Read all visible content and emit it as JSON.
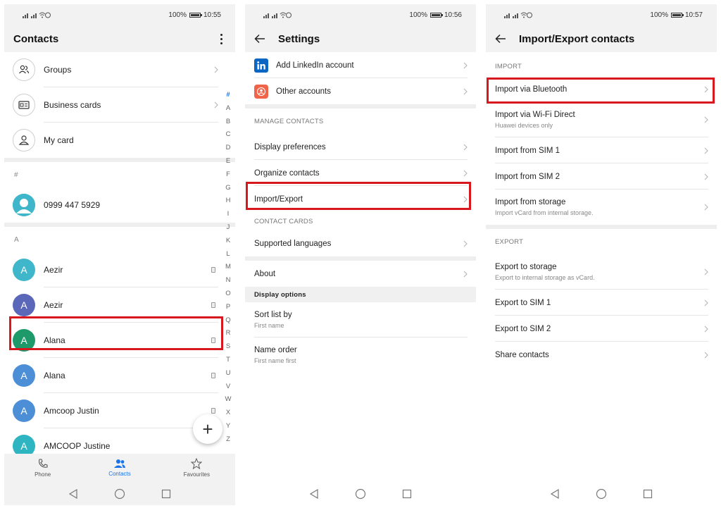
{
  "screens": [
    {
      "status": {
        "battery": "100%",
        "time": "10:55"
      },
      "title": "Contacts",
      "menu": [
        {
          "label": "Groups",
          "icon": "group-icon"
        },
        {
          "label": "Business cards",
          "icon": "business-card-icon"
        },
        {
          "label": "My card",
          "icon": "person-icon"
        }
      ],
      "hash_section": "#",
      "phone_contact": "0999 447 5929",
      "a_section": "A",
      "contacts": [
        {
          "initial": "A",
          "name": "Aezir",
          "color": "#3fb6c9"
        },
        {
          "initial": "A",
          "name": "Aezir",
          "color": "#5b67b8"
        },
        {
          "initial": "A",
          "name": "Alana",
          "color": "#1e9a6a"
        },
        {
          "initial": "A",
          "name": "Alana",
          "color": "#4d8fd6"
        },
        {
          "initial": "A",
          "name": "Amcoop Justin",
          "color": "#4d8fd6"
        },
        {
          "initial": "A",
          "name": "AMCOOP Justine",
          "color": "#2fb4c2"
        }
      ],
      "index": [
        "#",
        "A",
        "B",
        "C",
        "D",
        "E",
        "F",
        "G",
        "H",
        "I",
        "J",
        "K",
        "L",
        "M",
        "N",
        "O",
        "P",
        "Q",
        "R",
        "S",
        "T",
        "U",
        "V",
        "W",
        "X",
        "Y",
        "Z"
      ],
      "fab": "+",
      "nav": {
        "phone": "Phone",
        "contacts": "Contacts",
        "favourites": "Favourites"
      }
    },
    {
      "status": {
        "battery": "100%",
        "time": "10:56"
      },
      "title": "Settings",
      "accounts": [
        {
          "label": "Add LinkedIn account",
          "icon": "linkedin-icon",
          "color": "#0a66c2"
        },
        {
          "label": "Other accounts",
          "icon": "account-icon",
          "color": "#f06449"
        }
      ],
      "manage_header": "MANAGE CONTACTS",
      "manage": [
        "Display preferences",
        "Organize contacts",
        "Import/Export"
      ],
      "cards_header": "CONTACT CARDS",
      "cards": [
        "Supported languages"
      ],
      "about": "About",
      "display_header": "Display options",
      "display": [
        {
          "primary": "Sort list by",
          "secondary": "First name"
        },
        {
          "primary": "Name order",
          "secondary": "First name first"
        }
      ]
    },
    {
      "status": {
        "battery": "100%",
        "time": "10:57"
      },
      "title": "Import/Export contacts",
      "import_header": "IMPORT",
      "imports": [
        {
          "primary": "Import via Bluetooth",
          "secondary": ""
        },
        {
          "primary": "Import via Wi-Fi Direct",
          "secondary": "Huawei devices only"
        },
        {
          "primary": "Import from SIM 1",
          "secondary": ""
        },
        {
          "primary": "Import from SIM 2",
          "secondary": ""
        },
        {
          "primary": "Import from storage",
          "secondary": "Import vCard from internal storage."
        }
      ],
      "export_header": "EXPORT",
      "exports": [
        {
          "primary": "Export to storage",
          "secondary": "Export to internal storage as vCard."
        },
        {
          "primary": "Export to SIM 1",
          "secondary": ""
        },
        {
          "primary": "Export to SIM 2",
          "secondary": ""
        },
        {
          "primary": "Share contacts",
          "secondary": ""
        }
      ]
    }
  ],
  "highlight_color": "#d7191f"
}
